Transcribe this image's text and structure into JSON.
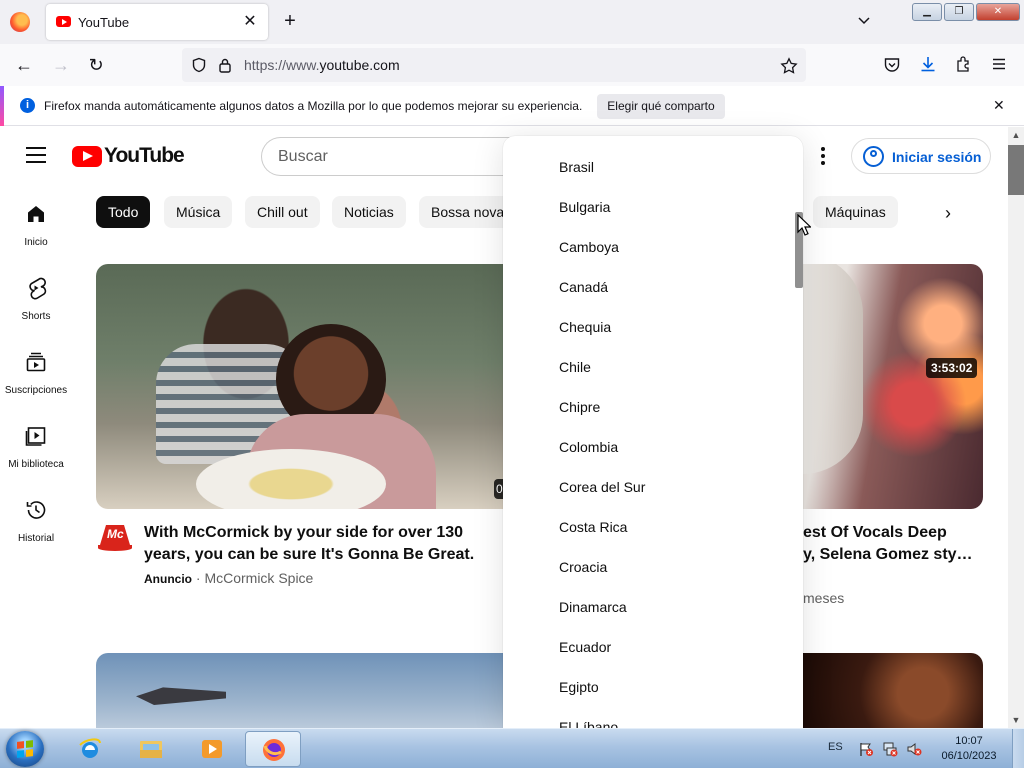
{
  "browser": {
    "tab_title": "YouTube",
    "url_prefix": "https://www.",
    "url_domain": "youtube.com",
    "infobar_text": "Firefox manda automáticamente algunos datos a Mozilla por lo que podemos mejorar su experiencia.",
    "infobar_button": "Elegir qué comparto"
  },
  "youtube": {
    "logo_text": "YouTube",
    "search_placeholder": "Buscar",
    "signin_label": "Iniciar sesión",
    "chips": [
      "Todo",
      "Música",
      "Chill out",
      "Noticias",
      "Bossa nova",
      "Máquinas"
    ],
    "sidebar": [
      "Inicio",
      "Shorts",
      "Suscripciones",
      "Mi biblioteca",
      "Historial"
    ],
    "video1": {
      "badge": "0",
      "title": "With McCormick by your side for over 130 years, you can be sure It's Gonna Be Great.",
      "ad_label": "Anuncio",
      "channel": " · McCormick Spice",
      "logo_text": "Mc"
    },
    "video2": {
      "duration": "3:53:02",
      "title_line1": "est Of Vocals Deep",
      "title_line2": "y, Selena Gomez sty…",
      "meta": "meses"
    }
  },
  "dropdown": {
    "countries": [
      "Brasil",
      "Bulgaria",
      "Camboya",
      "Canadá",
      "Chequia",
      "Chile",
      "Chipre",
      "Colombia",
      "Corea del Sur",
      "Costa Rica",
      "Croacia",
      "Dinamarca",
      "Ecuador",
      "Egipto",
      "El Líbano"
    ]
  },
  "taskbar": {
    "lang": "ES",
    "time": "10:07",
    "date": "06/10/2023"
  },
  "colors": {
    "youtube_red": "#ff0000",
    "link_blue": "#065fd4",
    "firefox_info_blue": "#0060df"
  }
}
